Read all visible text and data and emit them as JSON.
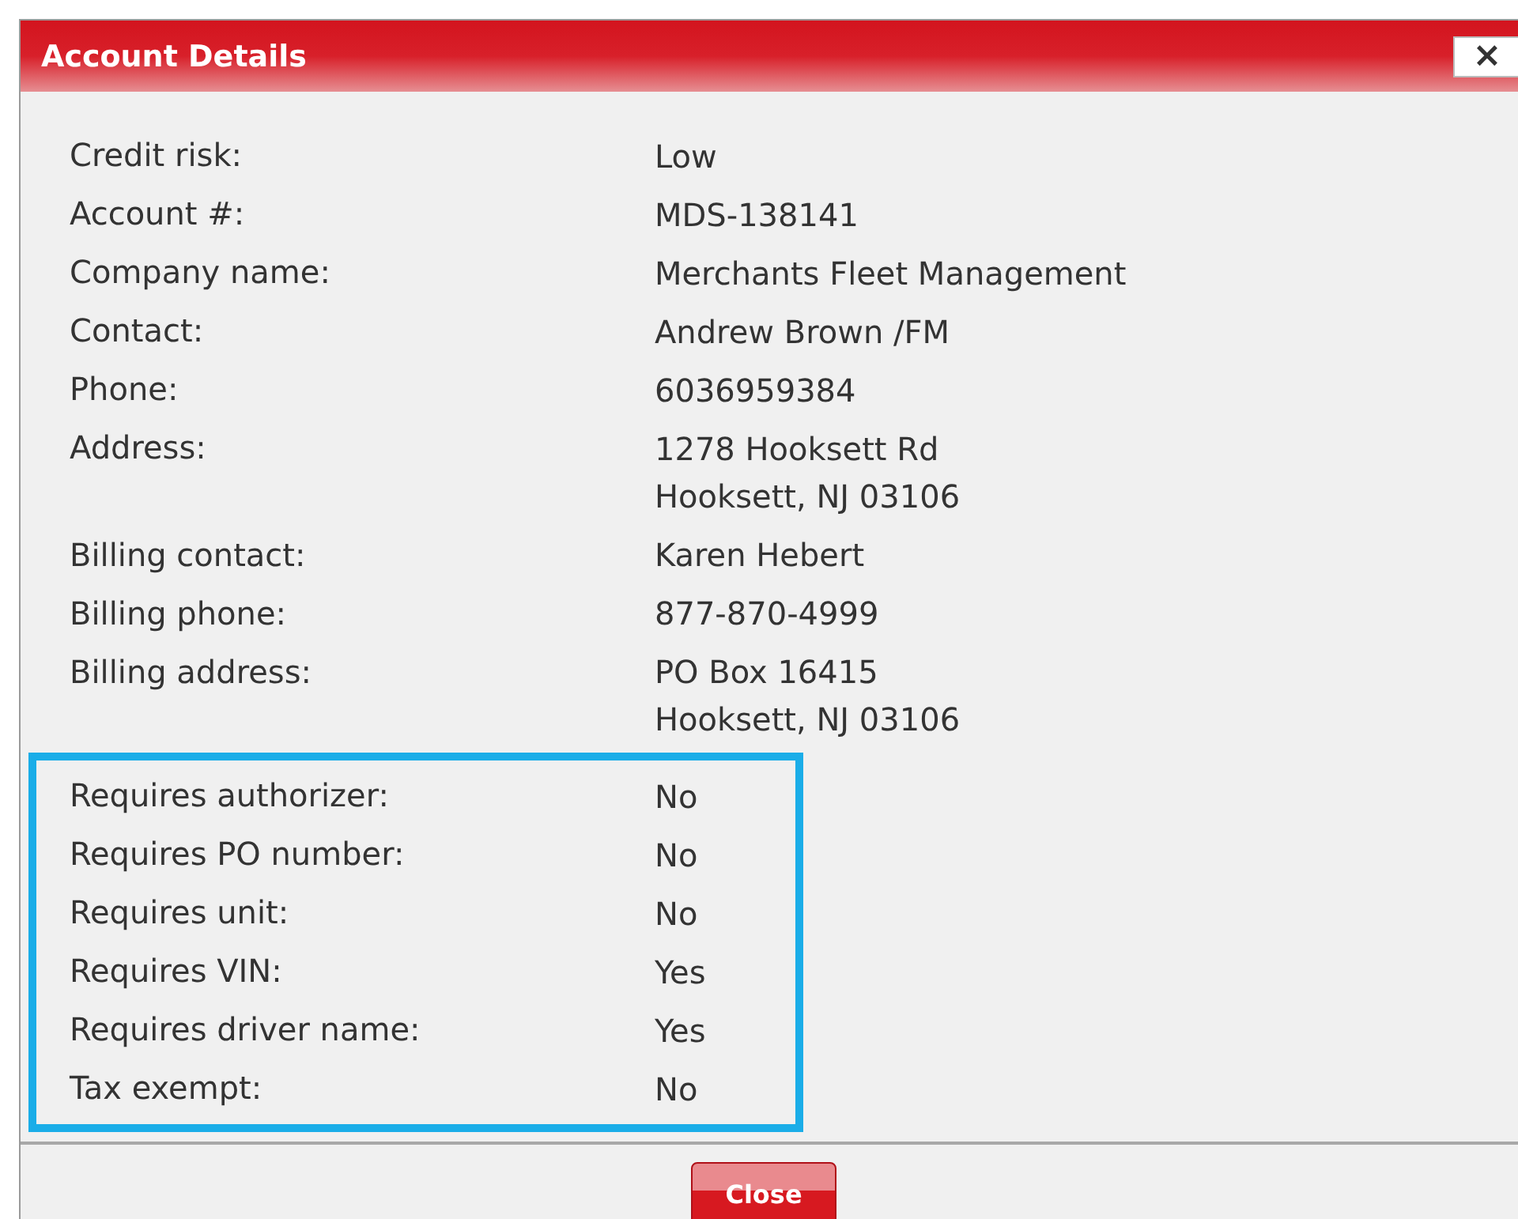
{
  "window": {
    "title": "Account Details",
    "close_glyph": "×"
  },
  "details": [
    {
      "label": "Credit risk:",
      "lines": [
        "Low"
      ]
    },
    {
      "label": "Account #:",
      "lines": [
        "MDS-138141"
      ]
    },
    {
      "label": "Company name:",
      "lines": [
        "Merchants Fleet Management"
      ]
    },
    {
      "label": "Contact:",
      "lines": [
        "Andrew Brown /FM"
      ]
    },
    {
      "label": "Phone:",
      "lines": [
        "6036959384"
      ]
    },
    {
      "label": "Address:",
      "lines": [
        "1278 Hooksett Rd",
        "Hooksett, NJ 03106"
      ]
    },
    {
      "label": "Billing contact:",
      "lines": [
        "Karen Hebert"
      ]
    },
    {
      "label": "Billing phone:",
      "lines": [
        "877-870-4999"
      ]
    },
    {
      "label": "Billing address:",
      "lines": [
        "PO Box 16415",
        "Hooksett, NJ 03106"
      ]
    }
  ],
  "highlighted_details": [
    {
      "label": "Requires authorizer:",
      "lines": [
        "No"
      ]
    },
    {
      "label": "Requires PO number:",
      "lines": [
        "No"
      ]
    },
    {
      "label": "Requires unit:",
      "lines": [
        "No"
      ]
    },
    {
      "label": "Requires VIN:",
      "lines": [
        "Yes"
      ]
    },
    {
      "label": "Requires driver name:",
      "lines": [
        "Yes"
      ]
    },
    {
      "label": "Tax exempt:",
      "lines": [
        "No"
      ]
    }
  ],
  "buttons": [
    "Close"
  ]
}
